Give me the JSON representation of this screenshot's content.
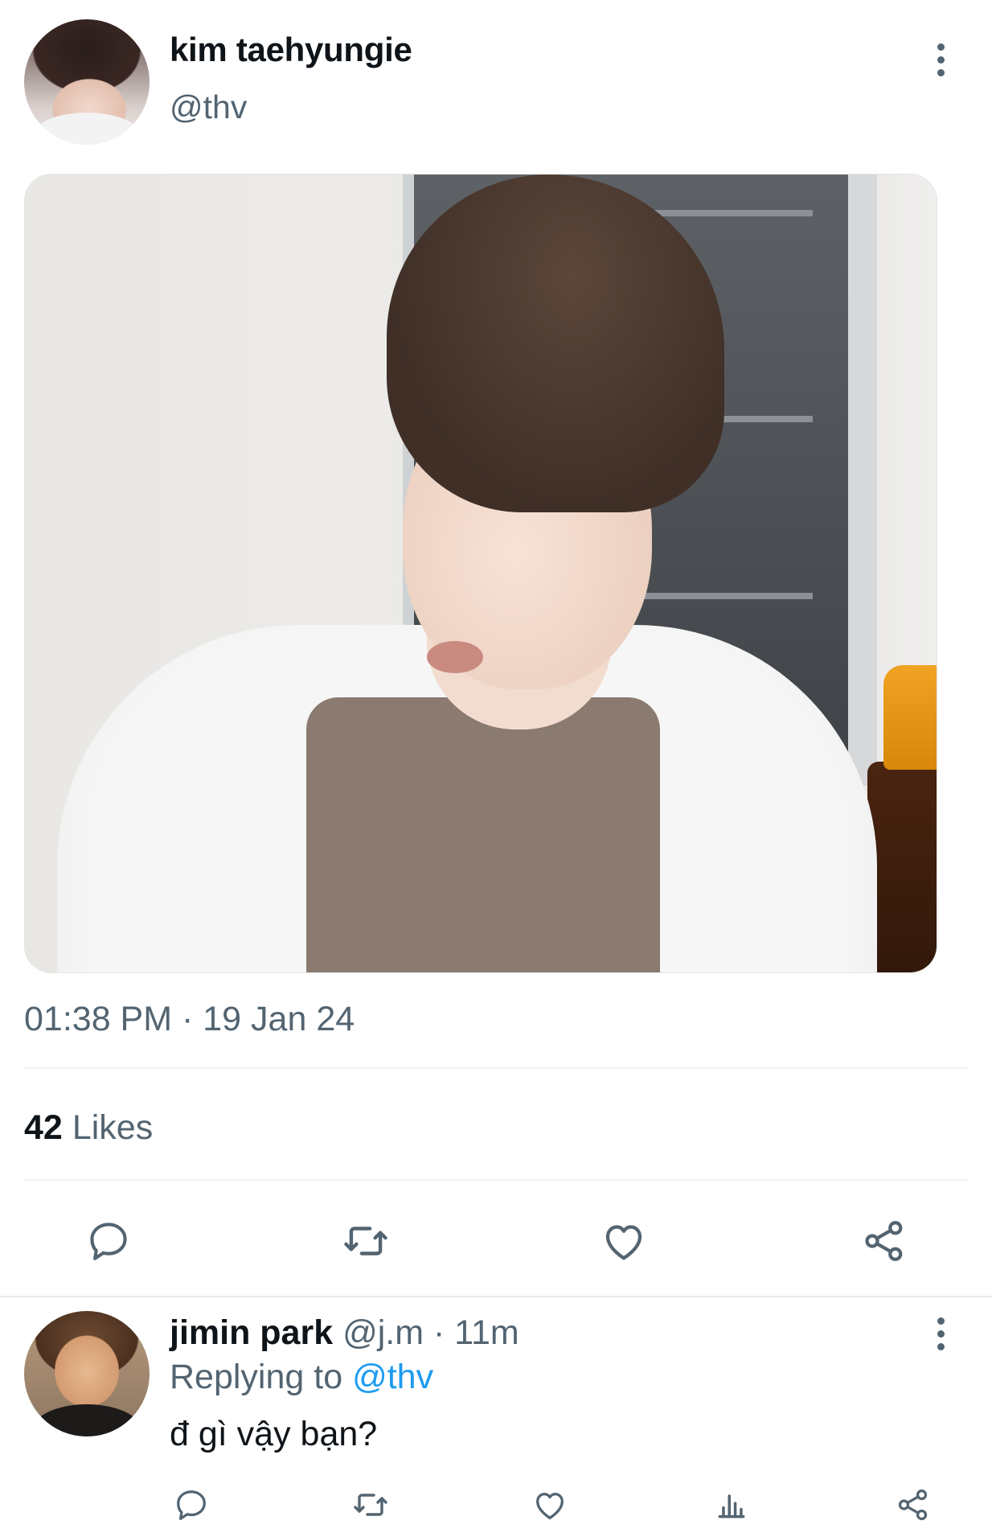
{
  "tweet": {
    "author_name": "kim taehyungie",
    "author_handle": "@thv",
    "timestamp": "01:38 PM · 19 Jan 24",
    "likes_count": "42",
    "likes_label": "Likes",
    "actions": [
      "reply-icon",
      "retweet-icon",
      "like-icon",
      "share-icon"
    ]
  },
  "reply": {
    "author_name": "jimin park",
    "author_handle": "@j.m",
    "separator": " · ",
    "time": "11m",
    "replying_to_label": "Replying to ",
    "replying_to_handle": "@thv",
    "text": "đ gì vậy bạn?",
    "actions": [
      "reply-icon",
      "retweet-icon",
      "like-icon",
      "views-icon",
      "share-icon"
    ]
  },
  "colors": {
    "text_primary": "#0f1419",
    "text_secondary": "#536471",
    "accent": "#1d9bf0",
    "divider": "#eff3f4"
  }
}
